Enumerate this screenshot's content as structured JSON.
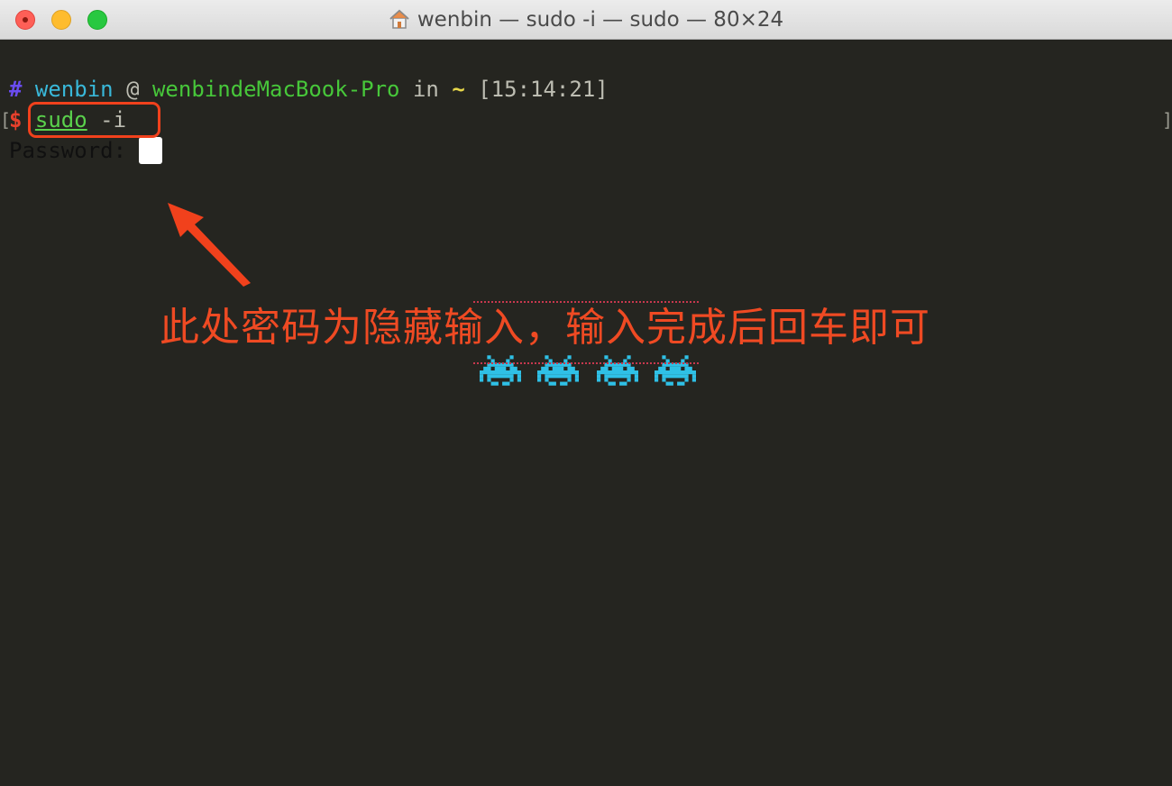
{
  "window": {
    "title": "wenbin — sudo -i — sudo — 80×24",
    "title_icon": "home-icon"
  },
  "prompt": {
    "hash": "#",
    "user": "wenbin",
    "at": "@",
    "host": "wenbindeMacBook-Pro",
    "in": "in",
    "dir": "~",
    "time": "[15:14:21]"
  },
  "command": {
    "open_bracket": "[",
    "dollar": "$",
    "cmd": "sudo",
    "args": "-i",
    "close_bracket": "]"
  },
  "password_prompt": "Password:",
  "annotation": {
    "text": "此处密码为隐藏输入，输入完成后回车即可",
    "color": "#ef4a23",
    "icons": [
      "space-invader-icon",
      "space-invader-icon",
      "space-invader-icon",
      "space-invader-icon"
    ],
    "icon_color": "#2fc0e6"
  },
  "colors": {
    "terminal_bg": "#252520",
    "highlight": "#f1411c"
  }
}
